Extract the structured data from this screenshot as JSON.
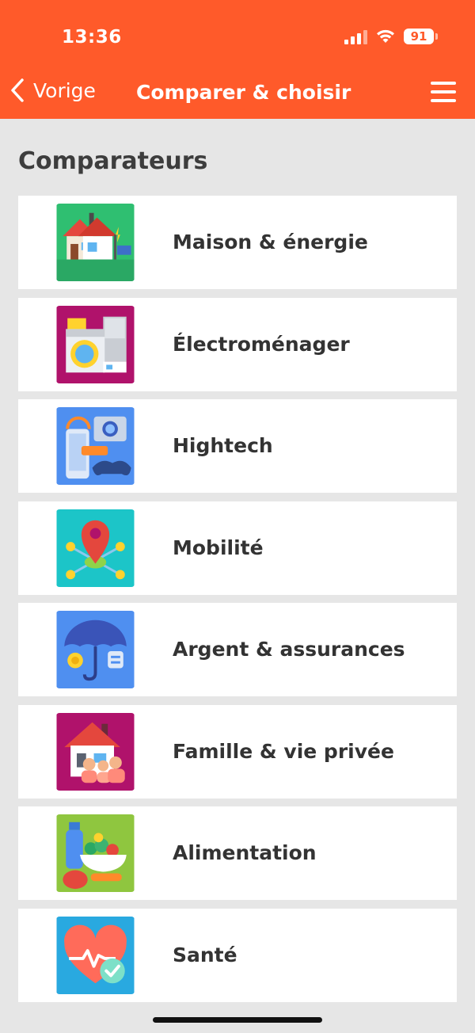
{
  "status_bar": {
    "time": "13:36",
    "battery": "91"
  },
  "header": {
    "back_label": "Vorige",
    "title": "Comparer & choisir",
    "accent_color": "#ff5a2a"
  },
  "section": {
    "title": "Comparateurs"
  },
  "items": [
    {
      "label": "Maison & énergie",
      "icon": "house-energy-icon",
      "bg": "#2fbf71"
    },
    {
      "label": "Électroménager",
      "icon": "appliances-icon",
      "bg": "#b0126b"
    },
    {
      "label": "Hightech",
      "icon": "hightech-icon",
      "bg": "#4f8ff0"
    },
    {
      "label": "Mobilité",
      "icon": "mobility-icon",
      "bg": "#1cc5c8"
    },
    {
      "label": "Argent & assurances",
      "icon": "money-insurance-icon",
      "bg": "#4f8ff0"
    },
    {
      "label": "Famille & vie privée",
      "icon": "family-icon",
      "bg": "#b0126b"
    },
    {
      "label": "Alimentation",
      "icon": "food-icon",
      "bg": "#8fc63f"
    },
    {
      "label": "Santé",
      "icon": "health-icon",
      "bg": "#29a9e0"
    }
  ]
}
